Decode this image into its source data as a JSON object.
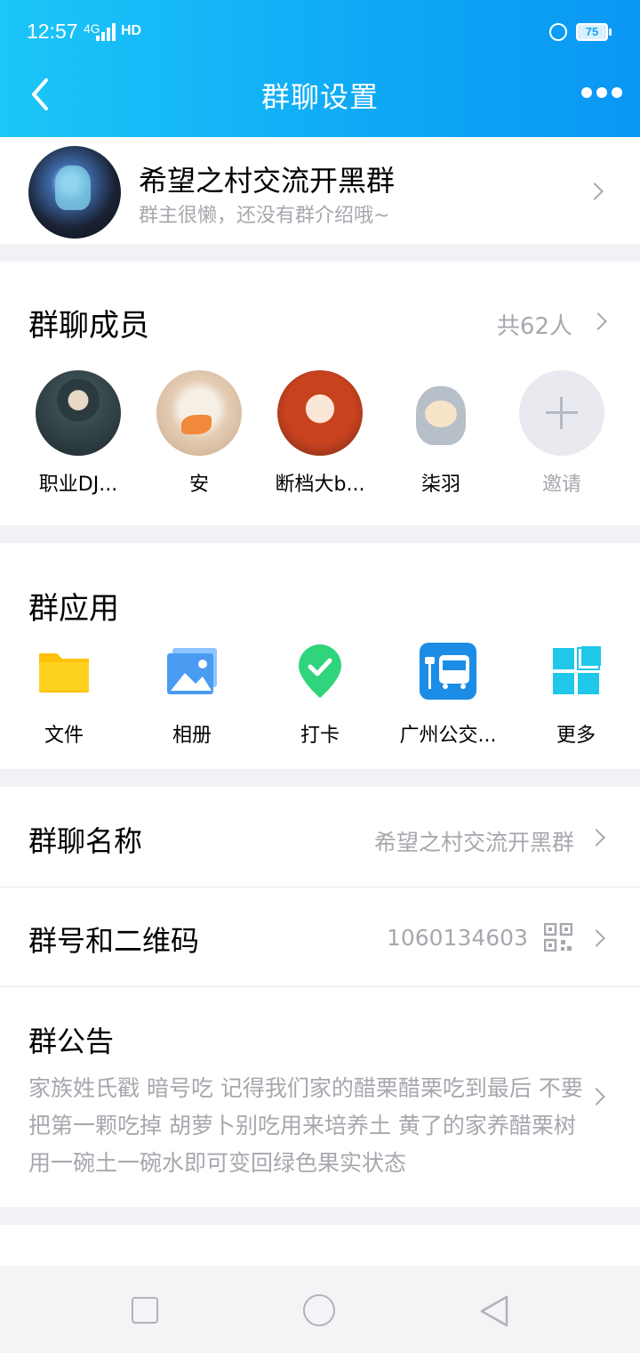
{
  "status_bar": {
    "time": "12:57",
    "signal": "4G",
    "hd": "HD",
    "battery": "75"
  },
  "header": {
    "title": "群聊设置"
  },
  "group": {
    "name": "希望之村交流开黑群",
    "description": "群主很懒，还没有群介绍哦~"
  },
  "members": {
    "title": "群聊成员",
    "count": "共62人",
    "list": [
      {
        "name": "职业DJ..."
      },
      {
        "name": "安"
      },
      {
        "name": "断档大b..."
      },
      {
        "name": "柒羽"
      }
    ],
    "invite_label": "邀请"
  },
  "apps": {
    "title": "群应用",
    "list": [
      {
        "name": "文件",
        "icon": "folder-icon"
      },
      {
        "name": "相册",
        "icon": "album-icon"
      },
      {
        "name": "打卡",
        "icon": "checkin-icon"
      },
      {
        "name": "广州公交...",
        "icon": "bus-icon"
      },
      {
        "name": "更多",
        "icon": "more-apps-icon"
      }
    ]
  },
  "settings": {
    "group_name": {
      "label": "群聊名称",
      "value": "希望之村交流开黑群"
    },
    "group_number": {
      "label": "群号和二维码",
      "value": "1060134603"
    },
    "notice": {
      "label": "群公告",
      "text": "家族姓氏戳 暗号吃 记得我们家的醋栗醋栗吃到最后 不要把第一颗吃掉 胡萝卜别吃用来培养土 黄了的家养醋栗树用一碗土一碗水即可变回绿色果实状态"
    }
  },
  "colors": {
    "accent": "#0ea8f5",
    "muted": "#a6a8ae",
    "background": "#f1f2f6"
  }
}
